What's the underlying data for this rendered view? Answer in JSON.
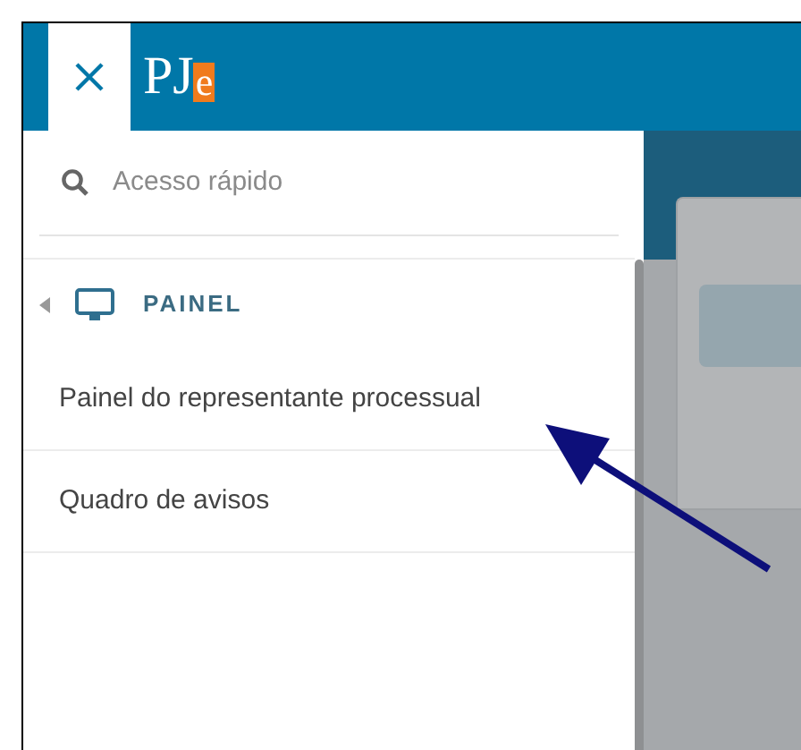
{
  "header": {
    "logo": {
      "text_1": "PJ",
      "text_2": "e"
    }
  },
  "sidebar": {
    "search": {
      "placeholder": "Acesso rápido"
    },
    "groups": [
      {
        "label": "PAINEL",
        "expanded": true,
        "children": [
          {
            "label": "Painel do representante processual"
          },
          {
            "label": "Quadro de avisos"
          }
        ]
      }
    ]
  }
}
